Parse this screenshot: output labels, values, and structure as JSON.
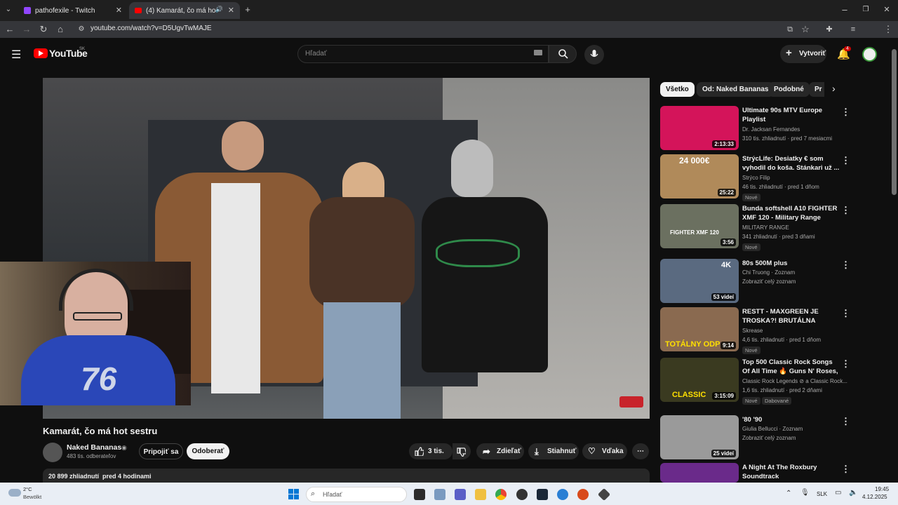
{
  "browser": {
    "tabs": [
      {
        "title": "pathofexile - Twitch"
      },
      {
        "title": "(4) Kamarát, čo má hot sestru"
      }
    ],
    "url": "youtube.com/watch?v=D5UgvTwMAJE"
  },
  "header": {
    "logo_text": "YouTube",
    "region": "SK",
    "search_placeholder": "Hľadať",
    "create_label": "Vytvoriť",
    "notifications_count": "4"
  },
  "video": {
    "title": "Kamarát, čo má hot sestru",
    "channel": "Naked Bananas",
    "subscribers": "483 tis. odberateľov",
    "join_label": "Pripojiť sa",
    "subscribe_label": "Odoberať",
    "likes": "3 tis.",
    "share_label": "Zdieľať",
    "download_label": "Stiahnuť",
    "thanks_label": "Vďaka",
    "views": "20 899 zhliadnutí",
    "age": "pred 4 hodinami"
  },
  "chips": [
    "Všetko",
    "Od: Naked Bananas",
    "Podobné",
    "Pr"
  ],
  "related": [
    {
      "title": "Ultimate 90s MTV Europe Playlist",
      "channel": "Dr. Jacksan Fernandes",
      "meta": "310 tis. zhliadnutí · pred 7 mesiacmi",
      "duration": "2:13:33",
      "badge": "",
      "thumb_color": "#d4145a"
    },
    {
      "title": "StrýcLife: Desiatky € som vyhodil do koša. Stánkari už ...",
      "channel": "Strýco Filip",
      "meta": "46 tis. zhliadnutí · pred 1 dňom",
      "duration": "25:22",
      "badge": "Nové",
      "thumb_color": "#b08a5a"
    },
    {
      "title": "Bunda softshell A10 FIGHTER XMF 120 - Military Range",
      "channel": "MILITARY RANGE",
      "meta": "341 zhliadnutí · pred 3 dňami",
      "duration": "3:56",
      "badge": "Nové",
      "thumb_color": "#6b7060"
    },
    {
      "title": "80s 500M plus",
      "channel": "Chi Truong · Zoznam",
      "meta": "Zobraziť celý zoznam",
      "duration": "53 videí",
      "badge": "",
      "thumb_color": "#5a6a80"
    },
    {
      "title": "RESTT - MAXGREEN JE TROSKA?! BRUTÁLNA REALIT...",
      "channel": "Skrease",
      "meta": "4,6 tis. zhliadnutí · pred 1 dňom",
      "duration": "9:14",
      "badge": "Nové",
      "thumb_color": "#8a6a50"
    },
    {
      "title": "Top 500 Classic Rock Songs Of All Time 🔥 Guns N' Roses, ...",
      "channel": "Classic Rock Legends ⊘ a Classic Rock...",
      "meta": "1,6 tis. zhliadnutí · pred 2 dňami",
      "duration": "3:15:09",
      "badge": "Nové",
      "badge2": "Dabované",
      "thumb_color": "#3a3a20"
    },
    {
      "title": "'80 '90",
      "channel": "Giulia Bellucci · Zoznam",
      "meta": "Zobraziť celý zoznam",
      "duration": "25 videí",
      "badge": "",
      "thumb_color": "#9a9a9a"
    },
    {
      "title": "A Night At The Roxbury Soundtrack",
      "channel": "",
      "meta": "",
      "duration": "",
      "badge": "",
      "thumb_color": "#6a2a8a"
    }
  ],
  "overlays": {
    "thumb_texts": [
      "24 000€",
      "FIGHTER XMF 120",
      "TOTÁLNY ODP",
      "CLASSIC",
      "4K"
    ]
  },
  "taskbar": {
    "weather_temp": "2°C",
    "weather_desc": "Bewölkt",
    "search_label": "Hľadať",
    "lang": "SLK",
    "time": "19:45",
    "date": "4.12.2025"
  }
}
